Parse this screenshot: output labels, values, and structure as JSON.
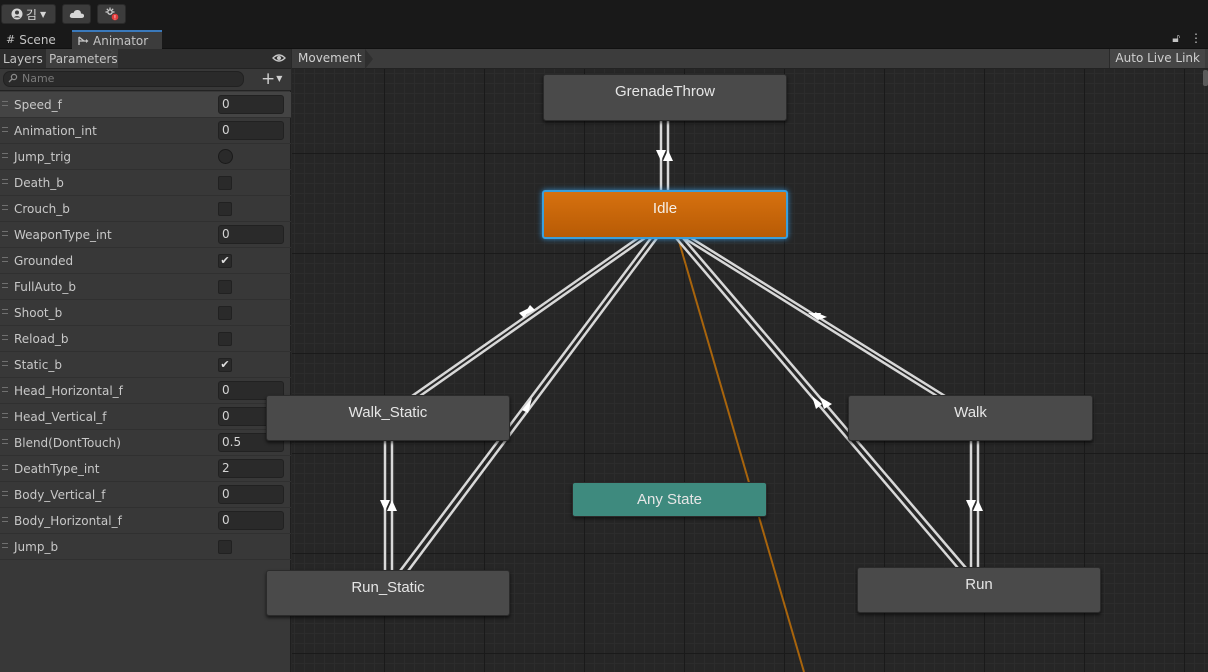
{
  "toolbar": {
    "account_label": "김",
    "account_icon": "user-icon",
    "cloud_icon": "cloud-icon",
    "collab_icon": "collab-icon"
  },
  "tabs": [
    {
      "label": "Scene",
      "icon": "grid-icon"
    },
    {
      "label": "Animator",
      "icon": "animator-icon"
    }
  ],
  "panel": {
    "tabs": [
      "Layers",
      "Parameters"
    ],
    "search_placeholder": "Name",
    "parameters": [
      {
        "name": "Speed_f",
        "type": "float",
        "value": "0"
      },
      {
        "name": "Animation_int",
        "type": "int",
        "value": "0"
      },
      {
        "name": "Jump_trig",
        "type": "trigger",
        "value": false
      },
      {
        "name": "Death_b",
        "type": "bool",
        "value": false
      },
      {
        "name": "Crouch_b",
        "type": "bool",
        "value": false
      },
      {
        "name": "WeaponType_int",
        "type": "int",
        "value": "0"
      },
      {
        "name": "Grounded",
        "type": "bool",
        "value": true
      },
      {
        "name": "FullAuto_b",
        "type": "bool",
        "value": false
      },
      {
        "name": "Shoot_b",
        "type": "bool",
        "value": false
      },
      {
        "name": "Reload_b",
        "type": "bool",
        "value": false
      },
      {
        "name": "Static_b",
        "type": "bool",
        "value": true
      },
      {
        "name": "Head_Horizontal_f",
        "type": "float",
        "value": "0"
      },
      {
        "name": "Head_Vertical_f",
        "type": "float",
        "value": "0"
      },
      {
        "name": "Blend(DontTouch)",
        "type": "float",
        "value": "0.5"
      },
      {
        "name": "DeathType_int",
        "type": "int",
        "value": "2"
      },
      {
        "name": "Body_Vertical_f",
        "type": "float",
        "value": "0"
      },
      {
        "name": "Body_Horizontal_f",
        "type": "float",
        "value": "0"
      },
      {
        "name": "Jump_b",
        "type": "bool",
        "value": false
      }
    ]
  },
  "graph": {
    "breadcrumb": "Movement",
    "auto_live_link": "Auto Live Link",
    "states": {
      "grenade_throw": "GrenadeThrow",
      "idle": "Idle",
      "walk_static": "Walk_Static",
      "walk": "Walk",
      "any_state": "Any State",
      "run_static": "Run_Static",
      "run": "Run"
    },
    "colors": {
      "default_state": "#4a4a4a",
      "entry_state": "#d6710f",
      "any_state": "#3e8a7e",
      "transition": "#d8d8d8",
      "any_transition": "#a8640c"
    }
  }
}
